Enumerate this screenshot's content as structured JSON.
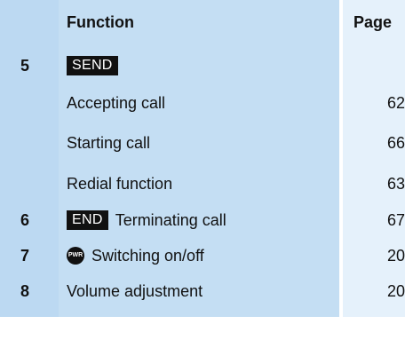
{
  "header": {
    "function": "Function",
    "page": "Page"
  },
  "rows": [
    {
      "num": "5",
      "key": "SEND",
      "label": "",
      "page": ""
    },
    {
      "num": "",
      "key": "",
      "label": "Accepting call",
      "page": "62"
    },
    {
      "num": "",
      "key": "",
      "label": "Starting call",
      "page": "66"
    },
    {
      "num": "",
      "key": "",
      "label": "Redial function",
      "page": "63"
    },
    {
      "num": "6",
      "key": "END",
      "label": "Terminating call",
      "page": "67"
    },
    {
      "num": "7",
      "icon": "PWR",
      "label": "Switching on/off",
      "page": "20"
    },
    {
      "num": "8",
      "key": "",
      "label": "Volume adjustment",
      "page": "20"
    }
  ]
}
